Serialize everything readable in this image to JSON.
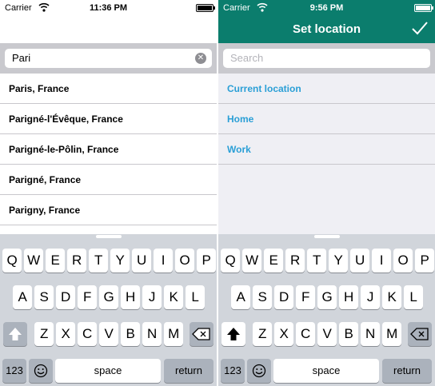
{
  "left": {
    "status": {
      "carrier": "Carrier",
      "time": "11:36 PM"
    },
    "search": {
      "value": "Pari"
    },
    "results": [
      "Paris, France",
      "Parigné-l'Évêque, France",
      "Parigné-le-Pôlin, France",
      "Parigné, France",
      "Parigny, France"
    ]
  },
  "right": {
    "status": {
      "carrier": "Carrier",
      "time": "9:56 PM"
    },
    "title": "Set location",
    "search": {
      "placeholder": "Search"
    },
    "options": [
      "Current location",
      "Home",
      "Work"
    ],
    "header_color": "#0b7d6d",
    "link_color": "#2a9fd6"
  },
  "keyboard": {
    "row1": [
      "Q",
      "W",
      "E",
      "R",
      "T",
      "Y",
      "U",
      "I",
      "O",
      "P"
    ],
    "row2": [
      "A",
      "S",
      "D",
      "F",
      "G",
      "H",
      "J",
      "K",
      "L"
    ],
    "row3": [
      "Z",
      "X",
      "C",
      "V",
      "B",
      "N",
      "M"
    ],
    "numbers_label": "123",
    "space_label": "space",
    "return_label": "return"
  }
}
